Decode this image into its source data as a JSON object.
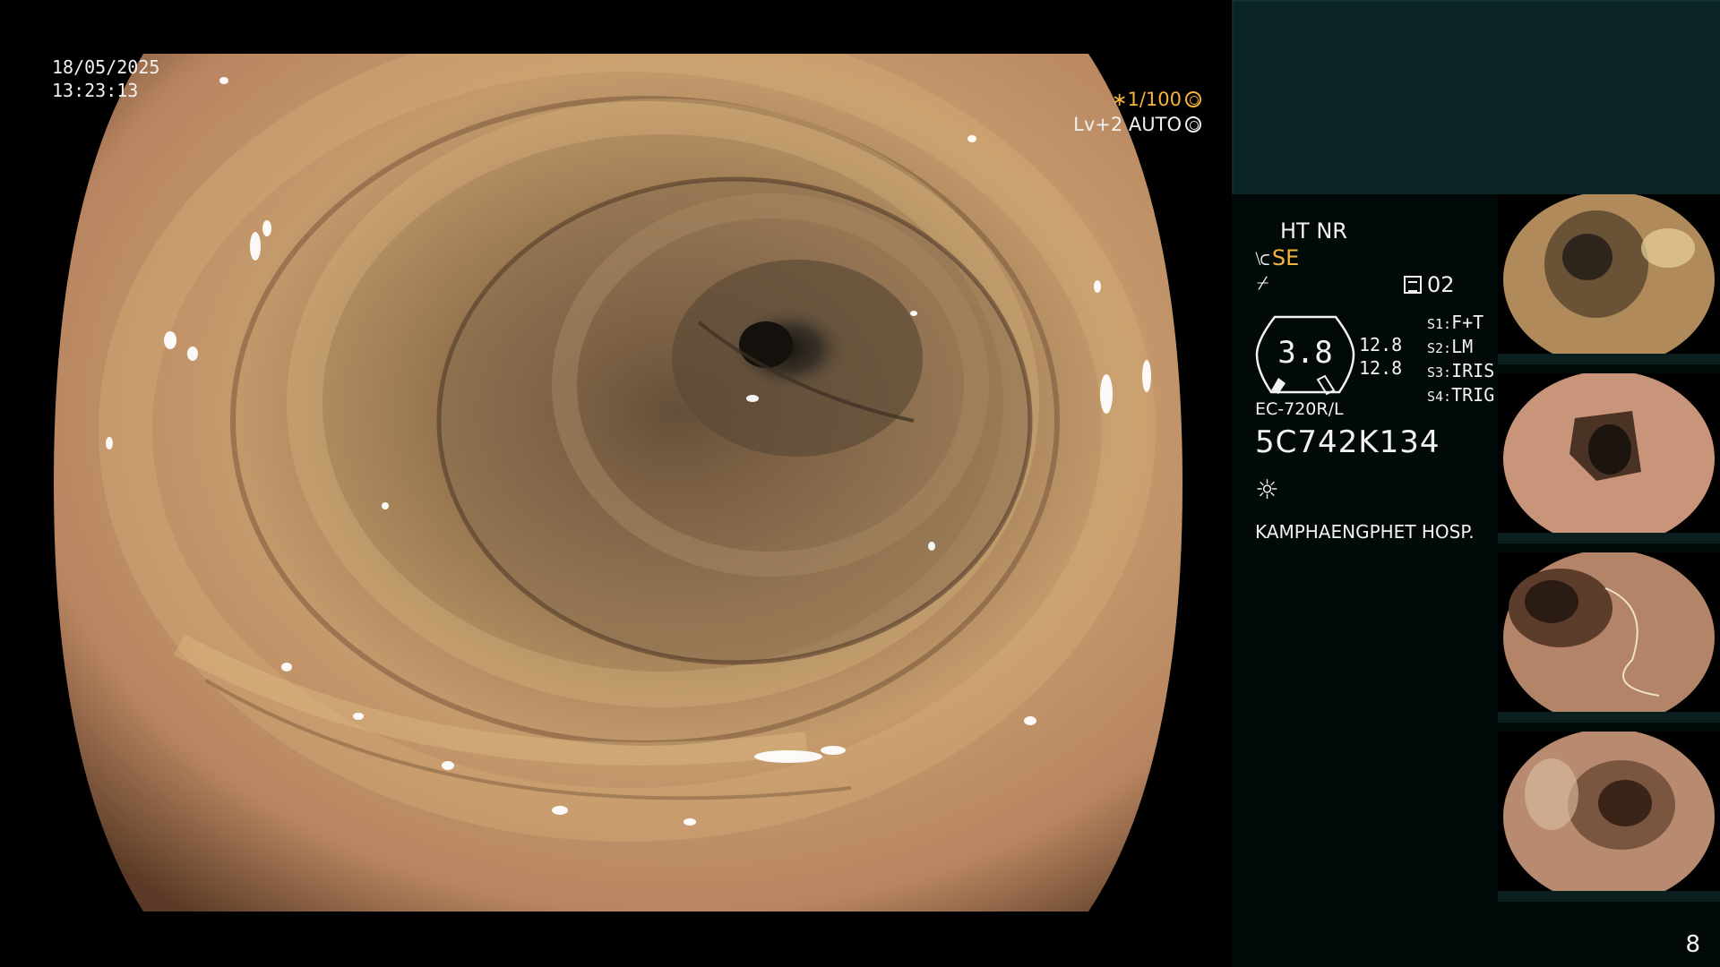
{
  "overlay": {
    "date": "18/05/2025",
    "time": "13:23:13",
    "shutter": "∗1/100",
    "shutter_icon": "aperture-icon",
    "iris": "Lv+2 AUTO",
    "iris_icon": "iris-icon"
  },
  "panel": {
    "ht_nr": "HT NR",
    "se": "SE",
    "se_icon": "enhance-icon",
    "zoom_icon": "zoom-icon",
    "pressure_icon": "chamber-icon",
    "pressure": "02",
    "gauge_value": "3.8",
    "scale_1": "12.8",
    "scale_2": "12.8",
    "switches": [
      {
        "key": "S1:",
        "value": "F+T"
      },
      {
        "key": "S2:",
        "value": "LM"
      },
      {
        "key": "S3:",
        "value": "IRIS"
      },
      {
        "key": "S4:",
        "value": "TRIG"
      }
    ],
    "model": "EC-720R/L",
    "serial": "5C742K134",
    "light_icon": "light-icon",
    "hospital": "KAMPHAENGPHET HOSP."
  },
  "page_number": "8",
  "colors": {
    "accent": "#f5b43c",
    "panel_top": "#0b2424",
    "panel_bg": "#020a09"
  }
}
